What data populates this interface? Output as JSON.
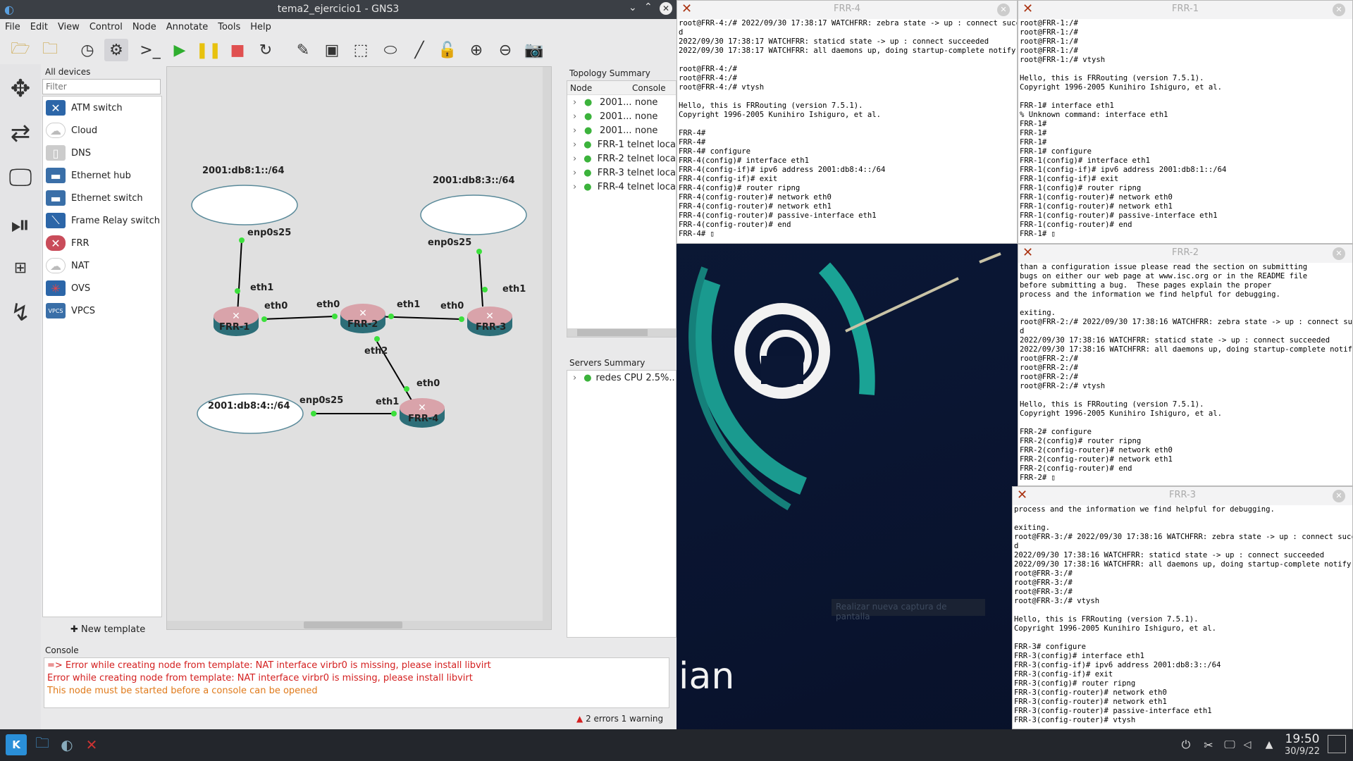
{
  "gns3": {
    "title": "tema2_ejercicio1 - GNS3",
    "menu": [
      "File",
      "Edit",
      "View",
      "Control",
      "Node",
      "Annotate",
      "Tools",
      "Help"
    ],
    "devices_panel": {
      "title": "All devices",
      "filter_placeholder": "Filter",
      "items": [
        {
          "label": "ATM switch",
          "icon": "atm-switch-icon"
        },
        {
          "label": "Cloud",
          "icon": "cloud-icon"
        },
        {
          "label": "DNS",
          "icon": "dns-icon"
        },
        {
          "label": "Ethernet hub",
          "icon": "ethernet-hub-icon"
        },
        {
          "label": "Ethernet switch",
          "icon": "ethernet-switch-icon"
        },
        {
          "label": "Frame Relay switch",
          "icon": "frame-relay-icon"
        },
        {
          "label": "FRR",
          "icon": "router-icon"
        },
        {
          "label": "NAT",
          "icon": "nat-icon"
        },
        {
          "label": "OVS",
          "icon": "ovs-icon"
        },
        {
          "label": "VPCS",
          "icon": "vpcs-icon"
        }
      ],
      "new_template": "New template"
    },
    "topology": {
      "clouds": [
        "2001:db8:1::/64",
        "2001:db8:3::/64",
        "2001:db8:4::/64"
      ],
      "routers": [
        "FRR-1",
        "FRR-2",
        "FRR-3",
        "FRR-4"
      ],
      "ports": {
        "c1": "enp0s25",
        "c3": "enp0s25",
        "c4": "enp0s25",
        "r1_eth1": "eth1",
        "r1_eth0": "eth0",
        "r2_eth0": "eth0",
        "r2_eth1": "eth1",
        "r2_eth2": "eth2",
        "r3_eth0": "eth0",
        "r3_eth1": "eth1",
        "r4_eth1": "eth1",
        "r4_eth0": "eth0"
      }
    },
    "topology_summary": {
      "title": "Topology Summary",
      "col_node": "Node",
      "col_console": "Console",
      "rows": [
        {
          "node": "2001...",
          "console": "none"
        },
        {
          "node": "2001...",
          "console": "none"
        },
        {
          "node": "2001...",
          "console": "none"
        },
        {
          "node": "FRR-1",
          "console": "telnet loca"
        },
        {
          "node": "FRR-2",
          "console": "telnet loca"
        },
        {
          "node": "FRR-3",
          "console": "telnet loca"
        },
        {
          "node": "FRR-4",
          "console": "telnet loca"
        }
      ]
    },
    "servers_summary": {
      "title": "Servers Summary",
      "row": "redes CPU 2.5%..."
    },
    "console": {
      "title": "Console",
      "lines": [
        {
          "text": "=> Error while creating node from template: NAT interface virbr0 is missing, please install libvirt",
          "color": "#d42020"
        },
        {
          "text": "Error while creating node from template: NAT interface virbr0 is missing, please install libvirt",
          "color": "#d42020"
        },
        {
          "text": "This node must be started before a console can be opened",
          "color": "#e07a1a"
        }
      ],
      "status": "2 errors 1 warning"
    }
  },
  "terminals": {
    "frr4": {
      "title": "FRR-4",
      "lines": [
        "root@FRR-4:/# 2022/09/30 17:38:17 WATCHFRR: zebra state -> up : connect succeede",
        "d",
        "2022/09/30 17:38:17 WATCHFRR: staticd state -> up : connect succeeded",
        "2022/09/30 17:38:17 WATCHFRR: all daemons up, doing startup-complete notify",
        "",
        "root@FRR-4:/#",
        "root@FRR-4:/#",
        "root@FRR-4:/# vtysh",
        "",
        "Hello, this is FRRouting (version 7.5.1).",
        "Copyright 1996-2005 Kunihiro Ishiguro, et al.",
        "",
        "FRR-4#",
        "FRR-4#",
        "FRR-4# configure",
        "FRR-4(config)# interface eth1",
        "FRR-4(config-if)# ipv6 address 2001:db8:4::/64",
        "FRR-4(config-if)# exit",
        "FRR-4(config)# router ripng",
        "FRR-4(config-router)# network eth0",
        "FRR-4(config-router)# network eth1",
        "FRR-4(config-router)# passive-interface eth1",
        "FRR-4(config-router)# end",
        "FRR-4# ▯"
      ]
    },
    "frr1": {
      "title": "FRR-1",
      "lines": [
        "root@FRR-1:/#",
        "root@FRR-1:/#",
        "root@FRR-1:/#",
        "root@FRR-1:/#",
        "root@FRR-1:/# vtysh",
        "",
        "Hello, this is FRRouting (version 7.5.1).",
        "Copyright 1996-2005 Kunihiro Ishiguro, et al.",
        "",
        "FRR-1# interface eth1",
        "% Unknown command: interface eth1",
        "FRR-1#",
        "FRR-1#",
        "FRR-1#",
        "FRR-1# configure",
        "FRR-1(config)# interface eth1",
        "FRR-1(config-if)# ipv6 address 2001:db8:1::/64",
        "FRR-1(config-if)# exit",
        "FRR-1(config)# router ripng",
        "FRR-1(config-router)# network eth0",
        "FRR-1(config-router)# network eth1",
        "FRR-1(config-router)# passive-interface eth1",
        "FRR-1(config-router)# end",
        "FRR-1# ▯"
      ]
    },
    "frr2": {
      "title": "FRR-2",
      "lines": [
        "than a configuration issue please read the section on submitting",
        "bugs on either our web page at www.isc.org or in the README file",
        "before submitting a bug.  These pages explain the proper",
        "process and the information we find helpful for debugging.",
        "",
        "exiting.",
        "root@FRR-2:/# 2022/09/30 17:38:16 WATCHFRR: zebra state -> up : connect succeed",
        "d",
        "2022/09/30 17:38:16 WATCHFRR: staticd state -> up : connect succeeded",
        "2022/09/30 17:38:16 WATCHFRR: all daemons up, doing startup-complete notify",
        "root@FRR-2:/#",
        "root@FRR-2:/#",
        "root@FRR-2:/#",
        "root@FRR-2:/# vtysh",
        "",
        "Hello, this is FRRouting (version 7.5.1).",
        "Copyright 1996-2005 Kunihiro Ishiguro, et al.",
        "",
        "FRR-2# configure",
        "FRR-2(config)# router ripng",
        "FRR-2(config-router)# network eth0",
        "FRR-2(config-router)# network eth1",
        "FRR-2(config-router)# end",
        "FRR-2# ▯"
      ]
    },
    "frr3": {
      "title": "FRR-3",
      "lines": [
        "process and the information we find helpful for debugging.",
        "",
        "exiting.",
        "root@FRR-3:/# 2022/09/30 17:38:16 WATCHFRR: zebra state -> up : connect succeede",
        "d",
        "2022/09/30 17:38:16 WATCHFRR: staticd state -> up : connect succeeded",
        "2022/09/30 17:38:16 WATCHFRR: all daemons up, doing startup-complete notify",
        "root@FRR-3:/#",
        "root@FRR-3:/#",
        "root@FRR-3:/#",
        "root@FRR-3:/# vtysh",
        "",
        "Hello, this is FRRouting (version 7.5.1).",
        "Copyright 1996-2005 Kunihiro Ishiguro, et al.",
        "",
        "FRR-3# configure",
        "FRR-3(config)# interface eth1",
        "FRR-3(config-if)# ipv6 address 2001:db8:3::/64",
        "FRR-3(config-if)# exit",
        "FRR-3(config)# router ripng",
        "FRR-3(config-router)# network eth0",
        "FRR-3(config-router)# network eth1",
        "FRR-3(config-router)# passive-interface eth1",
        "FRR-3(config-router)# vtysh"
      ]
    }
  },
  "desktop": {
    "wallpaper_text": "ian",
    "tooltip": "Realizar nueva captura de pantalla"
  },
  "taskbar": {
    "time": "19:50",
    "date": "30/9/22",
    "apps": [
      "kde-menu-icon",
      "file-manager-icon",
      "gns3-icon",
      "xterm-icon"
    ]
  }
}
